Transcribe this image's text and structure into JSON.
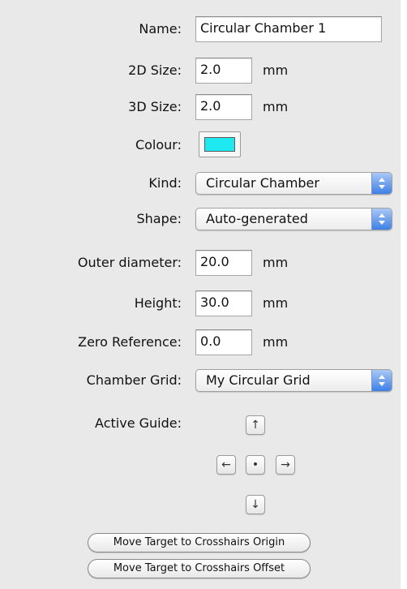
{
  "colors": {
    "panel_bg": "#e9e9e9",
    "swatch": "#1ee8f0",
    "popup_accent": "#3d80e6"
  },
  "fields": {
    "name": {
      "label": "Name:",
      "value": "Circular Chamber 1"
    },
    "size_2d": {
      "label": "2D Size:",
      "value": "2.0",
      "unit": "mm"
    },
    "size_3d": {
      "label": "3D Size:",
      "value": "2.0",
      "unit": "mm"
    },
    "colour": {
      "label": "Colour:"
    },
    "kind": {
      "label": "Kind:",
      "selected": "Circular Chamber"
    },
    "shape": {
      "label": "Shape:",
      "selected": "Auto-generated"
    },
    "outer_diameter": {
      "label": "Outer diameter:",
      "value": "20.0",
      "unit": "mm"
    },
    "height": {
      "label": "Height:",
      "value": "30.0",
      "unit": "mm"
    },
    "zero_reference": {
      "label": "Zero Reference:",
      "value": "0.0",
      "unit": "mm"
    },
    "chamber_grid": {
      "label": "Chamber Grid:",
      "selected": "My Circular Grid"
    },
    "active_guide": {
      "label": "Active Guide:",
      "up": "↑",
      "left": "←",
      "center": "•",
      "right": "→",
      "down": "↓"
    }
  },
  "buttons": {
    "move_origin": "Move Target to Crosshairs Origin",
    "move_offset": "Move Target to Crosshairs Offset"
  },
  "icons": {
    "popup_arrows": "up-down-chevron-icon",
    "arrow_up": "arrow-up-icon",
    "arrow_left": "arrow-left-icon",
    "arrow_right": "arrow-right-icon",
    "arrow_down": "arrow-down-icon",
    "center_dot": "dot-icon"
  }
}
